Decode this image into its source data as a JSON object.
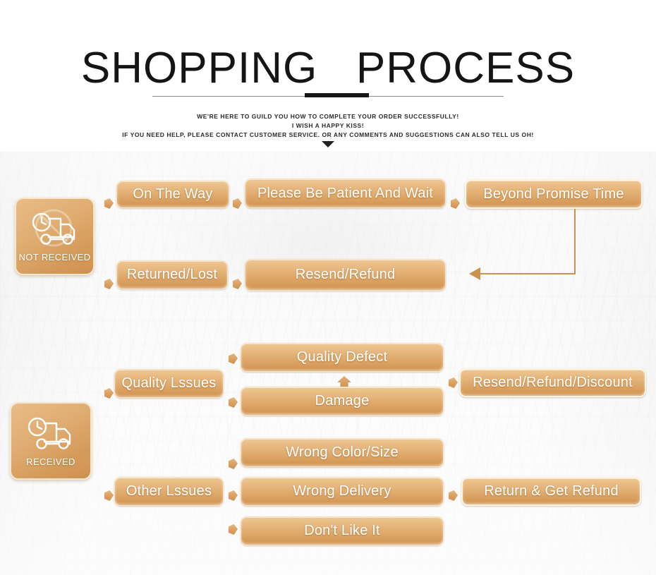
{
  "header": {
    "title": "SHOPPING   PROCESS",
    "subtitle_lines": [
      "WE'RE HERE TO GUILD YOU HOW TO COMPLETE YOUR ORDER SUCCESSFULLY!",
      "I WISH A HAPPY KISS!",
      "IF YOU NEED HELP, PLEASE CONTACT CUSTOMER SERVICE. OR ANY COMMENTS AND SUGGESTIONS CAN ALSO TELL US OH!"
    ],
    "caret_icon": "caret-down-icon"
  },
  "colors": {
    "pill_top": "#efc793",
    "pill_bottom": "#d1924f",
    "pill_border": "#f6e3c4",
    "connector": "#c9924f",
    "title_text": "#151515",
    "accent_rule": "#151515",
    "top_hairline": "#e9f7f4"
  },
  "status": {
    "not_received": {
      "label": "NOT RECEIVED",
      "icon": "truck-clock-prohibited-icon"
    },
    "received": {
      "label": "RECEIVED",
      "icon": "truck-clock-icon"
    }
  },
  "flow": {
    "not_received_row1": [
      {
        "label": "On The Way"
      },
      {
        "label": "Please Be Patient And Wait"
      },
      {
        "label": "Beyond Promise Time"
      }
    ],
    "not_received_row2": [
      {
        "label": "Returned/Lost"
      },
      {
        "label": "Resend/Refund"
      }
    ],
    "quality_issues": {
      "label": "Quality Lssues"
    },
    "quality_reasons": [
      {
        "label": "Quality Defect"
      },
      {
        "label": "Damage"
      }
    ],
    "quality_outcome": {
      "label": "Resend/Refund/Discount"
    },
    "other_issues": {
      "label": "Other Lssues"
    },
    "other_reasons": [
      {
        "label": "Wrong Color/Size"
      },
      {
        "label": "Wrong Delivery"
      },
      {
        "label": "Don't Like It"
      }
    ],
    "other_outcome": {
      "label": "Return & Get Refund"
    }
  }
}
